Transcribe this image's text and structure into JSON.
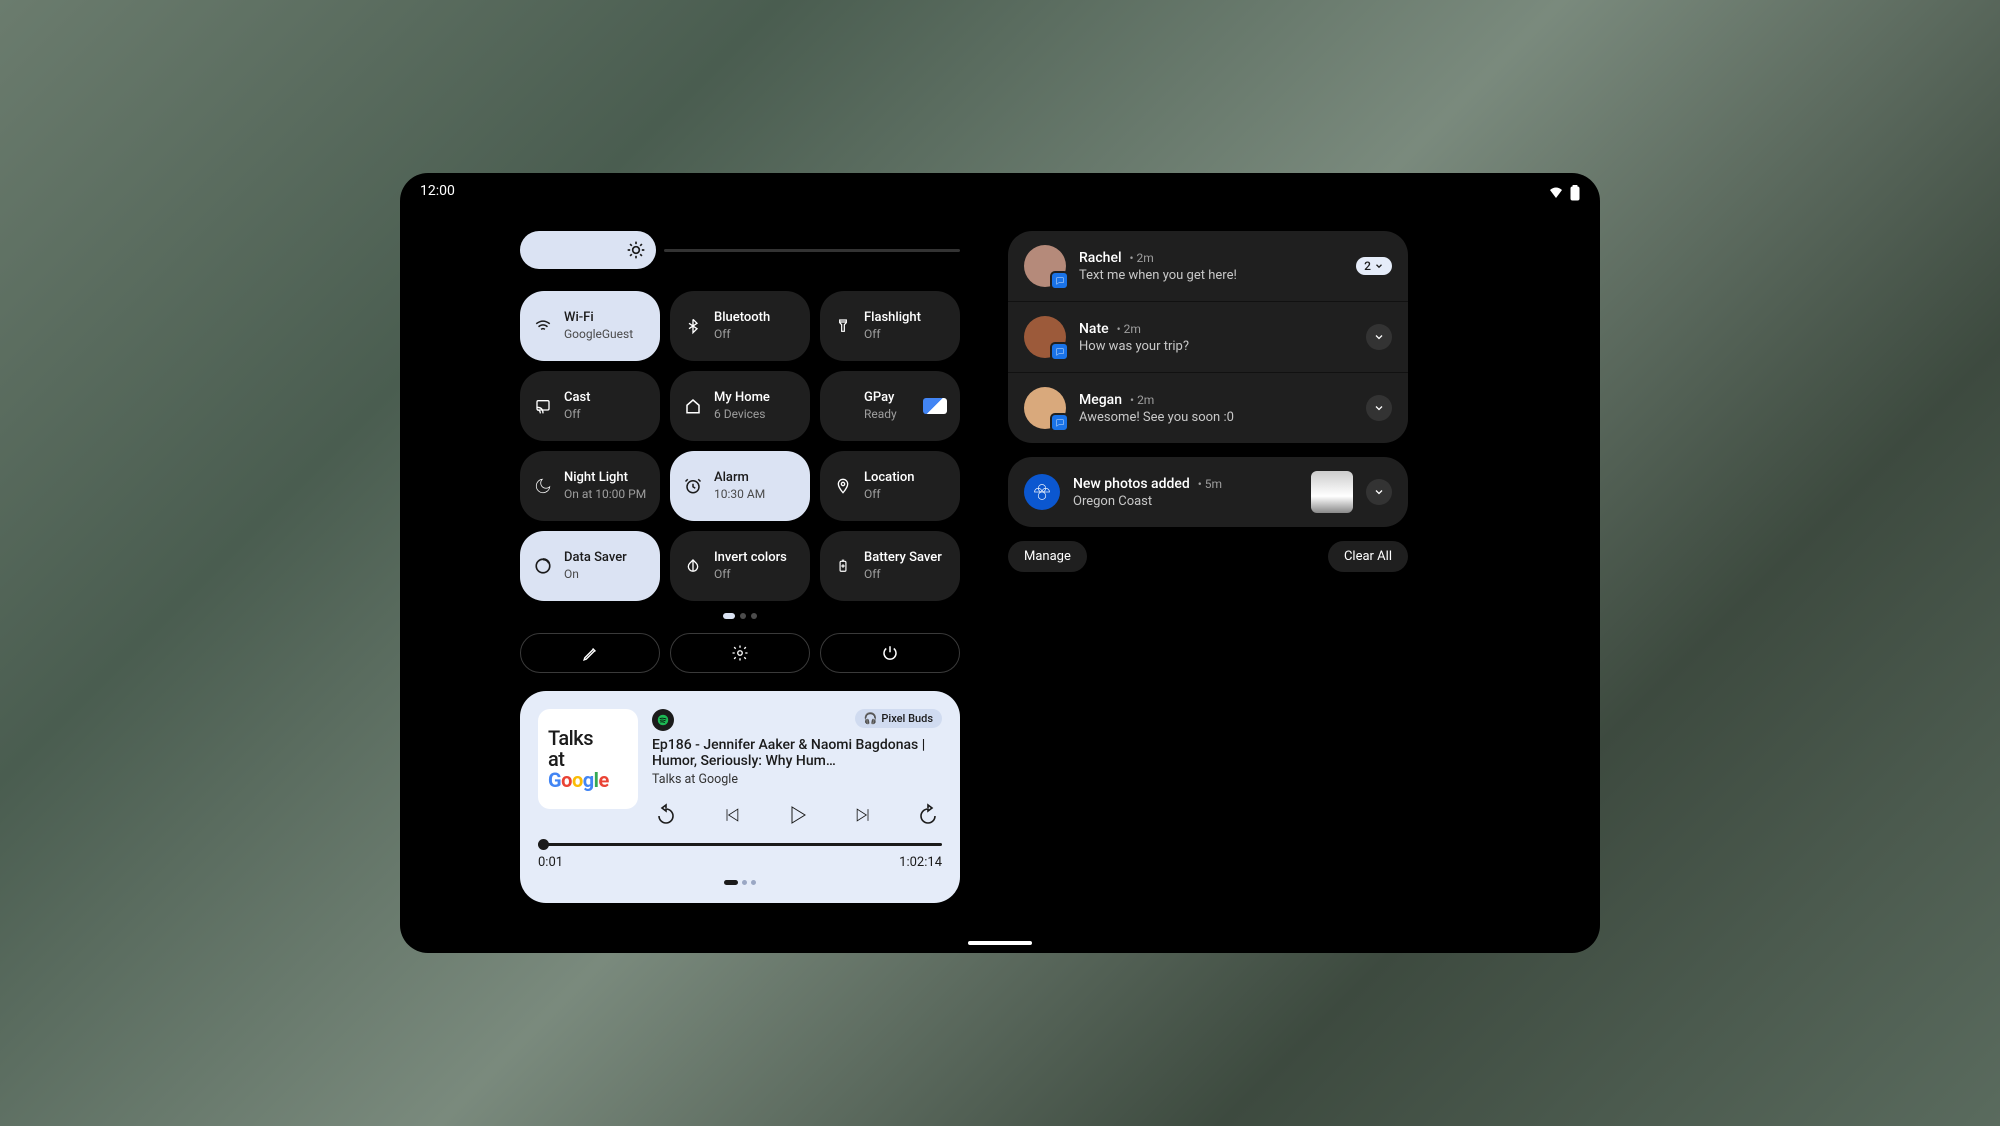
{
  "statusbar": {
    "time": "12:00"
  },
  "brightness": {
    "percent": 31
  },
  "tiles": [
    {
      "key": "wifi",
      "title": "Wi-Fi",
      "sub": "GoogleGuest",
      "on": true
    },
    {
      "key": "bluetooth",
      "title": "Bluetooth",
      "sub": "Off",
      "on": false
    },
    {
      "key": "flashlight",
      "title": "Flashlight",
      "sub": "Off",
      "on": false
    },
    {
      "key": "cast",
      "title": "Cast",
      "sub": "Off",
      "on": false
    },
    {
      "key": "home-control",
      "title": "My Home",
      "sub": "6 Devices",
      "on": false
    },
    {
      "key": "gpay",
      "title": "GPay",
      "sub": "Ready",
      "on": false,
      "chip": true
    },
    {
      "key": "night-light",
      "title": "Night Light",
      "sub": "On at 10:00 PM",
      "on": false
    },
    {
      "key": "alarm",
      "title": "Alarm",
      "sub": "10:30 AM",
      "on": true
    },
    {
      "key": "location",
      "title": "Location",
      "sub": "Off",
      "on": false
    },
    {
      "key": "data-saver",
      "title": "Data Saver",
      "sub": "On",
      "on": true
    },
    {
      "key": "invert-colors",
      "title": "Invert colors",
      "sub": "Off",
      "on": false
    },
    {
      "key": "battery-saver",
      "title": "Battery Saver",
      "sub": "Off",
      "on": false
    }
  ],
  "media": {
    "app": "Spotify",
    "output_chip": "Pixel Buds",
    "album_art_text_l1": "Talks",
    "album_art_text_l2": "at",
    "album_art_text_l3": "Google",
    "title": "Ep186 - Jennifer Aaker & Naomi Bagdonas | Humor, Seriously: Why Hum…",
    "artist": "Talks at Google",
    "skip_back_seconds": "15",
    "skip_fwd_seconds": "15",
    "elapsed": "0:01",
    "total": "1:02:14"
  },
  "notifications": {
    "convos": [
      {
        "name": "Rachel",
        "time": "2m",
        "text": "Text me when you get here!",
        "count": "2",
        "app": "messages"
      },
      {
        "name": "Nate",
        "time": "2m",
        "text": "How was your trip?",
        "app": "messages"
      },
      {
        "name": "Megan",
        "time": "2m",
        "text": "Awesome! See you soon :0",
        "app": "messages"
      }
    ],
    "other": [
      {
        "title": "New photos added",
        "time": "5m",
        "sub": "Oregon Coast",
        "app": "photos"
      }
    ],
    "manage_label": "Manage",
    "clear_label": "Clear All"
  }
}
